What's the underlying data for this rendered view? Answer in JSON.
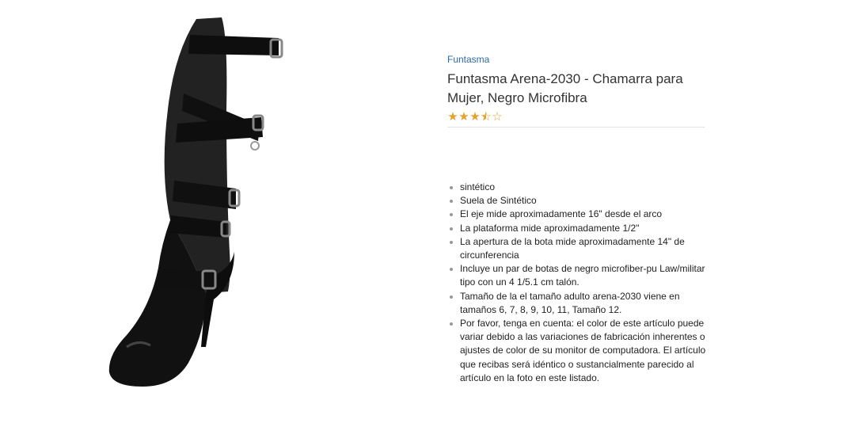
{
  "product": {
    "brand": "Funtasma",
    "title": "Funtasma Arena-2030 - Chamarra para Mujer, Negro Microfibra",
    "rating": 3.5,
    "rating_max": 5,
    "image_icon": "black-knee-high-buckle-boot"
  },
  "features": [
    "sintético",
    "Suela de Sintético",
    "El eje mide aproximadamente 16\" desde el arco",
    "La plataforma mide aproximadamente 1/2\"",
    "La apertura de la bota mide aproximadamente 14\" de circunferencia",
    "Incluye un par de botas de negro microfiber-pu Law/militar tipo con un 4 1/5.1 cm talón.",
    "Tamaño de la el tamaño adulto arena-2030 viene en tamaños 6, 7, 8, 9, 10, 11, Tamaño 12.",
    "Por favor, tenga en cuenta: el color de este artículo puede variar debido a las variaciones de fabricación inherentes o ajustes de color de su monitor de computadora. El artículo que recibas será idéntico o sustancialmente parecido al artículo en la foto en este listado."
  ],
  "colors": {
    "link": "#2b6aa6",
    "star": "#e7a12a",
    "boot": "#1a1a1a"
  }
}
